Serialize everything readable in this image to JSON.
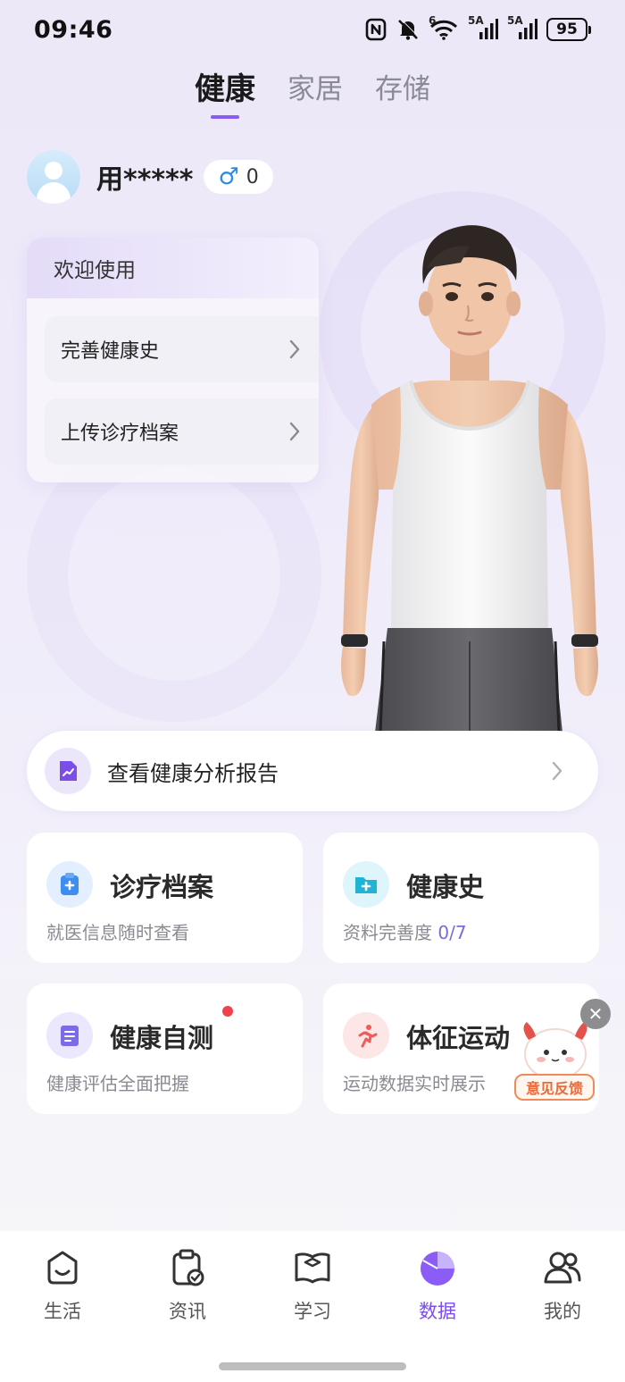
{
  "status_bar": {
    "time": "09:46",
    "battery": "95",
    "icons": [
      "nfc-icon",
      "mute-bell-icon",
      "wifi-6-icon",
      "signal-5a-icon",
      "signal-5a-icon",
      "battery-icon"
    ],
    "wifi_label": "6",
    "signal1_label": "5A",
    "signal2_label": "5A"
  },
  "top_tabs": [
    {
      "label": "健康",
      "active": true
    },
    {
      "label": "家居",
      "active": false
    },
    {
      "label": "存储",
      "active": false
    }
  ],
  "user": {
    "name": "用*****",
    "gender_symbol": "♂",
    "gender_value": "0"
  },
  "welcome_card": {
    "title": "欢迎使用",
    "items": [
      {
        "label": "完善健康史"
      },
      {
        "label": "上传诊疗档案"
      }
    ]
  },
  "report": {
    "label": "查看健康分析报告"
  },
  "cards": [
    {
      "title": "诊疗档案",
      "subtitle": "就医信息随时查看",
      "icon": "medical-record-icon",
      "color": "#3d8ef0"
    },
    {
      "title": "健康史",
      "subtitle": "资料完善度",
      "progress": "0/7",
      "icon": "health-folder-icon",
      "color": "#21b3d6"
    },
    {
      "title": "健康自测",
      "subtitle": "健康评估全面把握",
      "icon": "self-test-icon",
      "color": "#7b6be6",
      "has_dot": true
    },
    {
      "title": "体征运动",
      "subtitle": "运动数据实时展示",
      "icon": "running-icon",
      "color": "#f05a5a"
    }
  ],
  "feedback": {
    "label": "意见反馈"
  },
  "bottom_nav": [
    {
      "label": "生活",
      "icon": "life-icon",
      "active": false
    },
    {
      "label": "资讯",
      "icon": "news-icon",
      "active": false
    },
    {
      "label": "学习",
      "icon": "book-icon",
      "active": false
    },
    {
      "label": "数据",
      "icon": "data-pie-icon",
      "active": true
    },
    {
      "label": "我的",
      "icon": "profile-icon",
      "active": false
    }
  ],
  "colors": {
    "accent": "#7c4ee8",
    "tab_indicator": "#8a5cf6",
    "progress": "#7a6bd6"
  }
}
